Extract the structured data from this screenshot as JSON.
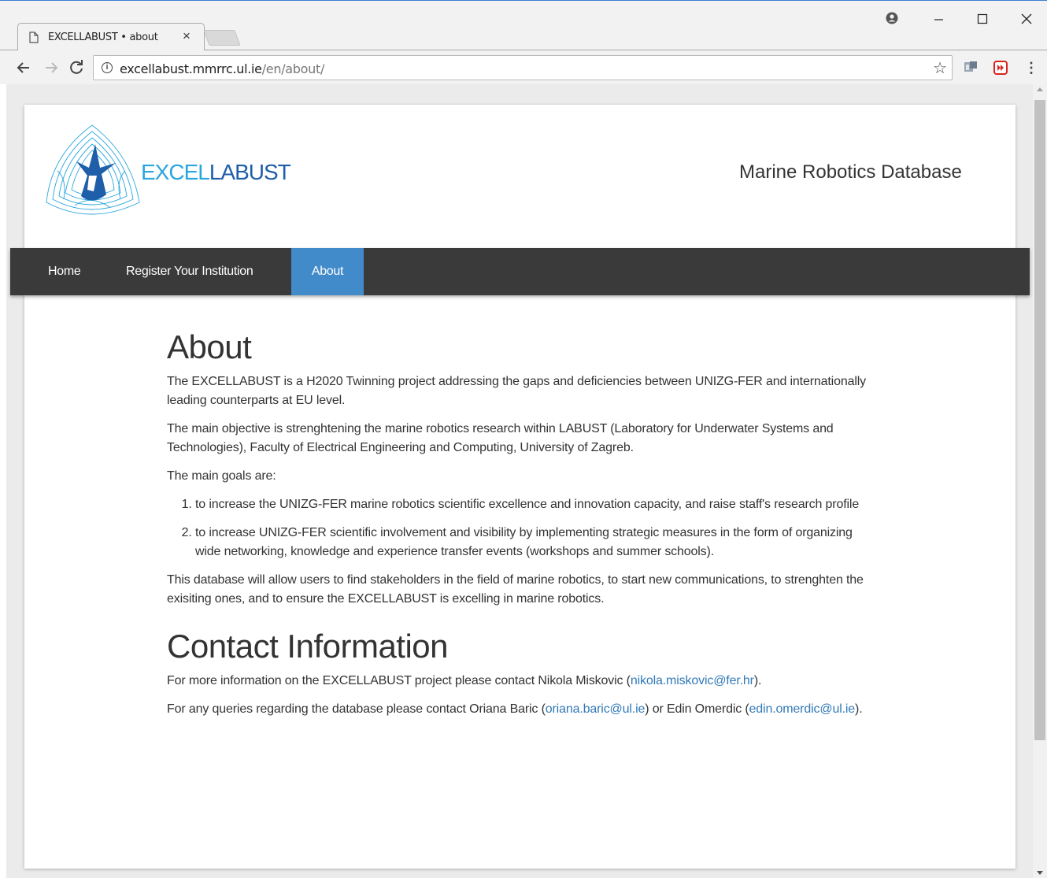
{
  "browser": {
    "tab_title": "EXCELLABUST • about",
    "tab_close": "×",
    "url_host": "excellabust.mmrrc.ul.ie",
    "url_path": "/en/about/",
    "icons": [
      "page-icon",
      "close-icon",
      "profile-icon",
      "minimize-icon",
      "maximize-icon",
      "window-close-icon",
      "back-icon",
      "forward-icon",
      "reload-icon",
      "info-icon",
      "star-icon",
      "extension-icon",
      "extension-red-icon",
      "menu-icon"
    ]
  },
  "header": {
    "brand_part1": "EXCEL",
    "brand_part2": "LABUST",
    "subtitle": "Marine Robotics Database"
  },
  "nav": {
    "items": [
      {
        "label": "Home"
      },
      {
        "label": "Register Your Institution"
      },
      {
        "label": "About"
      }
    ],
    "active_color": "#428bca",
    "bar_color": "#3a3a3a"
  },
  "about": {
    "heading": "About",
    "p1": "The EXCELLABUST is a H2020 Twinning project addressing the gaps and deficiencies between UNIZG-FER and internationally leading counterparts at EU level.",
    "p2": "The main objective is strenghtening the marine robotics research within LABUST (Laboratory for Underwater Systems and Technologies), Faculty of Electrical Engineering and Computing, University of Zagreb.",
    "p3": "The main goals are:",
    "goals": [
      "to increase the UNIZG-FER marine robotics scientific excellence and innovation capacity, and raise staff's research profile",
      "to increase UNIZG-FER scientific involvement and visibility by implementing strategic measures in the form of organizing wide networking, knowledge and experience transfer events (workshops and summer schools)."
    ],
    "p4": "This database will allow users to find stakeholders in the field of marine robotics, to start new communications, to strenghten the exisiting ones, and to ensure the EXCELLABUST is excelling in marine robotics."
  },
  "contact": {
    "heading": "Contact Information",
    "line1_pre": "For more information on the EXCELLABUST project please contact Nikola Miskovic (",
    "line1_email": "nikola.miskovic@fer.hr",
    "line1_post": ").",
    "line2_pre": "For any queries regarding the database please contact Oriana Baric (",
    "line2_email1": "oriana.baric@ul.ie",
    "line2_mid": ") or Edin Omerdic (",
    "line2_email2": "edin.omerdic@ul.ie",
    "line2_post": ")."
  },
  "colors": {
    "link": "#337ab7",
    "brand_light": "#2aa6de",
    "brand_dark": "#1f5ea8"
  }
}
